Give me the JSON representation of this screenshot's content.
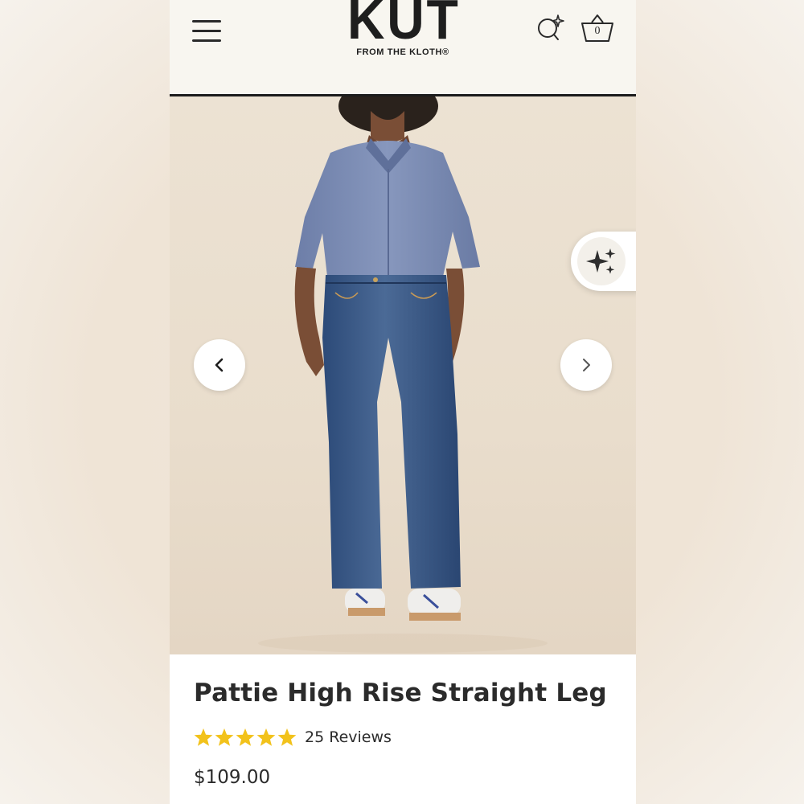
{
  "header": {
    "logo_main": "KUT",
    "logo_sub": "FROM THE KLOTH®",
    "cart_count": "0"
  },
  "icons": {
    "menu": "hamburger-menu-icon",
    "search": "sparkle-search-icon",
    "cart": "basket-icon",
    "ai": "sparkles-icon",
    "prev": "chevron-left-icon",
    "next": "chevron-right-icon",
    "star": "star-icon"
  },
  "product": {
    "title": "Pattie High Rise Straight Leg",
    "rating": 5,
    "rating_max": 5,
    "reviews_label": "25 Reviews",
    "price": "$109.00"
  },
  "colors": {
    "star": "#f2c21b",
    "text": "#2b2b2b",
    "header_bg": "#f8f6f0"
  }
}
